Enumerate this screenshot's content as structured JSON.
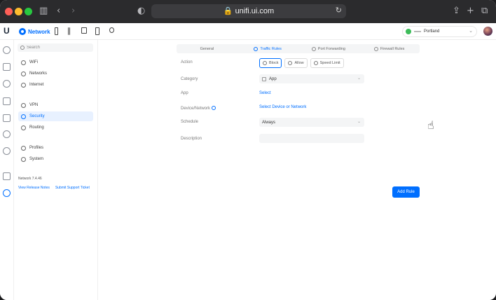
{
  "browser": {
    "url": "unifi.ui.com",
    "lock_icon": "lock-icon",
    "reload_icon": "reload-icon"
  },
  "header": {
    "brand": "Network",
    "site_name": "Portland"
  },
  "sidebar": {
    "search_placeholder": "Search",
    "items": [
      {
        "label": "WiFi",
        "icon": "wifi-icon"
      },
      {
        "label": "Networks",
        "icon": "networks-icon"
      },
      {
        "label": "Internet",
        "icon": "globe-icon"
      },
      {
        "label": "VPN",
        "icon": "vpn-icon"
      },
      {
        "label": "Security",
        "icon": "shield-icon",
        "active": true
      },
      {
        "label": "Routing",
        "icon": "routing-icon"
      },
      {
        "label": "Profiles",
        "icon": "profiles-icon"
      },
      {
        "label": "System",
        "icon": "system-icon"
      }
    ],
    "version": "Network 7.4.46",
    "release_notes": "View Release Notes",
    "support_ticket": "Submit Support Ticket"
  },
  "tabs": [
    {
      "label": "General"
    },
    {
      "label": "Traffic Rules",
      "active": true
    },
    {
      "label": "Port Forwarding"
    },
    {
      "label": "Firewall Rules"
    }
  ],
  "form": {
    "action_label": "Action",
    "actions": [
      "Block",
      "Allow",
      "Speed Limit"
    ],
    "selected_action": "Block",
    "category_label": "Category",
    "category_value": "App",
    "app_label": "App",
    "app_link": "Select",
    "device_label": "Device/Network",
    "device_link": "Select Device or Network",
    "schedule_label": "Schedule",
    "schedule_value": "Always",
    "description_label": "Description",
    "description_value": ""
  },
  "add_rule_button": "Add Rule",
  "colors": {
    "accent": "#006fff",
    "browser_bar": "#2b2b2d"
  }
}
